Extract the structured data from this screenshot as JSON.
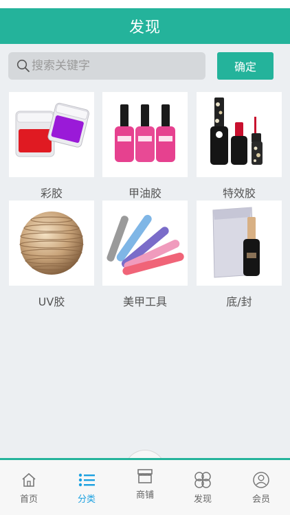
{
  "header": {
    "title": "发现"
  },
  "search": {
    "placeholder": "搜索关键字",
    "confirm_label": "确定"
  },
  "categories": [
    {
      "label": "彩胶"
    },
    {
      "label": "甲油胶"
    },
    {
      "label": "特效胶"
    },
    {
      "label": "UV胶"
    },
    {
      "label": "美甲工具"
    },
    {
      "label": "底/封"
    }
  ],
  "tabbar": {
    "items": [
      {
        "label": "首页",
        "icon": "home-icon"
      },
      {
        "label": "分类",
        "icon": "list-icon"
      },
      {
        "label": "商铺",
        "icon": "store-icon"
      },
      {
        "label": "发现",
        "icon": "clover-icon"
      },
      {
        "label": "会员",
        "icon": "user-icon"
      }
    ],
    "active_index": 1
  },
  "colors": {
    "brand": "#24b39b",
    "active_tab": "#1aa0e0",
    "background": "#eceff2"
  }
}
